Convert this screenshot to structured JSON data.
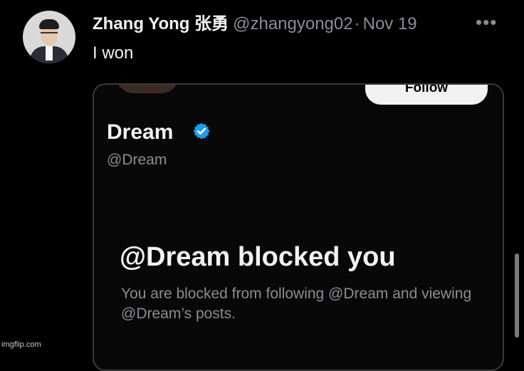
{
  "tweet": {
    "author_name": "Zhang Yong 张勇",
    "handle": "@zhangyong02",
    "separator": "·",
    "date": "Nov 19",
    "more_label": "•••",
    "text": "I won"
  },
  "embedded_screenshot": {
    "follow_label": "Follow",
    "profile_name": "Dream",
    "profile_handle": "@Dream",
    "blocked_title": "@Dream blocked you",
    "blocked_description": "You are blocked from following @Dream and viewing @Dream’s posts."
  },
  "icons": {
    "verified": "verified-badge-icon",
    "more": "more-options-icon"
  },
  "colors": {
    "background": "#000000",
    "text_primary": "#f2f2f2",
    "text_secondary": "#8a8d91",
    "verified_blue": "#1d9bf0"
  },
  "watermark": "imgflip.com"
}
